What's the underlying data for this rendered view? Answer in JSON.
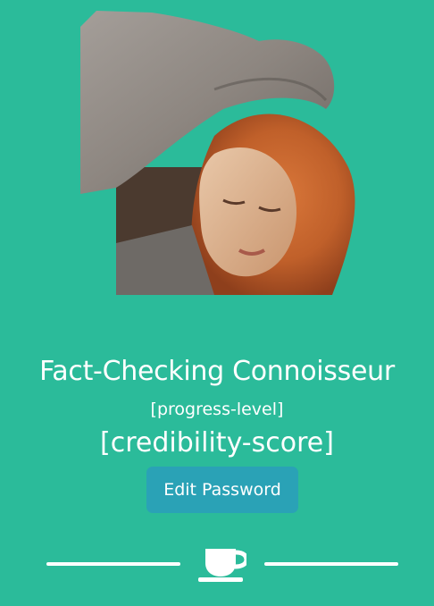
{
  "profile": {
    "avatar_icon": "user-avatar-image",
    "title": "Fact-Checking Connoisseur",
    "progress_level": "[progress-level]",
    "credibility_score": "[credibility-score]"
  },
  "actions": {
    "edit_password_label": "Edit Password"
  },
  "footer": {
    "icon": "coffee-cup-icon"
  },
  "colors": {
    "background": "#2bbb9a",
    "button": "#2aa2b6",
    "text": "#ffffff"
  }
}
